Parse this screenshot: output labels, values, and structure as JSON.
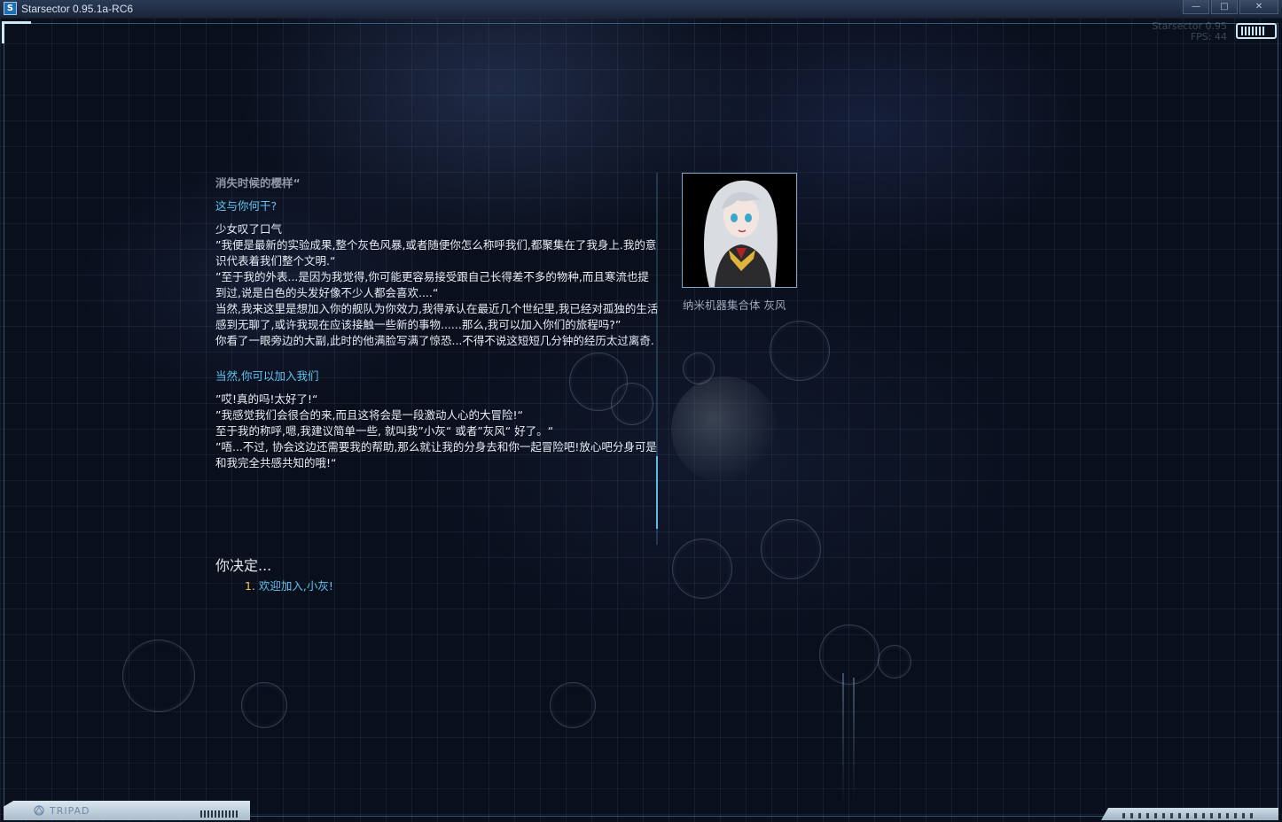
{
  "window": {
    "title": "Starsector 0.95.1a-RC6",
    "app_icon_letter": "S",
    "minimize": "—",
    "maximize": "□",
    "close": "✕"
  },
  "hud": {
    "version_text": "Starsector 0.95",
    "fps_text": "FPS: 44"
  },
  "dialog": {
    "lines": [
      {
        "text": "消失时候的樱样“",
        "style": "dim"
      },
      {
        "text": "这与你何干?",
        "style": "choice"
      },
      {
        "text": "少女叹了口气",
        "style": "normal"
      },
      {
        "text": "”我便是最新的实验成果,整个灰色风暴,或者随便你怎么称呼我们,都聚集在了我身上.我的意识代表着我们整个文明.“",
        "style": "normal"
      },
      {
        "text": "”至于我的外表...是因为我觉得,你可能更容易接受跟自己长得差不多的物种,而且寒流也提到过,说是白色的头发好像不少人都会喜欢....“",
        "style": "normal"
      },
      {
        "text": "当然,我来这里是想加入你的舰队为你效力,我得承认在最近几个世纪里,我已经对孤独的生活感到无聊了,或许我现在应该接触一些新的事物......那么,我可以加入你们的旅程吗?”",
        "style": "normal"
      },
      {
        "text": "你看了一眼旁边的大副,此时的他满脸写满了惊恐...不得不说这短短几分钟的经历太过离奇.",
        "style": "normal"
      },
      {
        "text": "当然,你可以加入我们",
        "style": "choice"
      },
      {
        "text": "”哎!真的吗!太好了!“",
        "style": "normal"
      },
      {
        "text": "”我感觉我们会很合的来,而且这将会是一段激动人心的大冒险!“",
        "style": "normal"
      },
      {
        "text": "至于我的称呼,嗯,我建议简单一些, 就叫我”小灰“ 或者”灰风“ 好了。“",
        "style": "normal"
      },
      {
        "text": "”唔...不过, 协会这边还需要我的帮助,那么就让我的分身去和你一起冒险吧!放心吧分身可是和我完全共感共知的哦!“",
        "style": "normal"
      }
    ],
    "decide_label": "你决定...",
    "options": [
      {
        "number": "1.",
        "text": "欢迎加入,小灰!"
      }
    ]
  },
  "portrait": {
    "name": "纳米机器集合体 灰风",
    "hair_color": "#d9dde2",
    "suit_color": "#2b2b2e",
    "accent_color": "#e0b43a"
  },
  "bottom_bar": {
    "brand": "TRIPAD"
  },
  "colors": {
    "choice_text": "#5fc3f0",
    "option_number": "#f2c14e",
    "frame": "#5aaadc"
  }
}
